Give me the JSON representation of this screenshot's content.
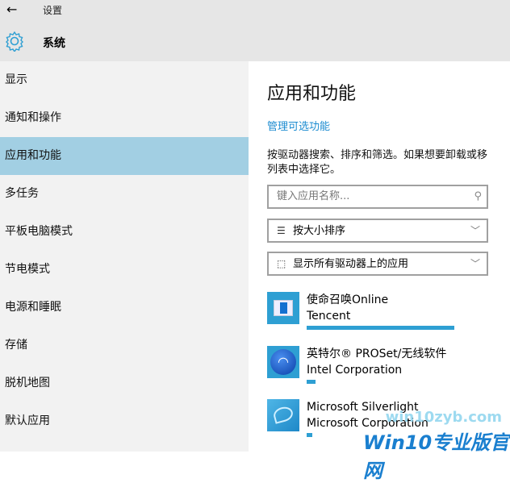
{
  "header": {
    "title": "设置",
    "section": "系统",
    "icons": {
      "back": "arrow-left-icon",
      "section": "gear-icon"
    }
  },
  "sidebar": {
    "items": [
      {
        "label": "显示"
      },
      {
        "label": "通知和操作"
      },
      {
        "label": "应用和功能",
        "selected": true
      },
      {
        "label": "多任务"
      },
      {
        "label": "平板电脑模式"
      },
      {
        "label": "节电模式"
      },
      {
        "label": "电源和睡眠"
      },
      {
        "label": "存储"
      },
      {
        "label": "脱机地图"
      },
      {
        "label": "默认应用"
      }
    ]
  },
  "main": {
    "title": "应用和功能",
    "link": "管理可选功能",
    "description": [
      "按驱动器搜索、排序和筛选。如果想要卸载或移",
      "列表中选择它。"
    ],
    "search": {
      "placeholder": "键入应用名称..."
    },
    "sort": {
      "value": "按大小排序"
    },
    "drive": {
      "value": "显示所有驱动器上的应用"
    },
    "apps": [
      {
        "name": "使命召唤Online",
        "publisher": "Tencent",
        "size_fraction": 1.0
      },
      {
        "name": "英特尔® PROSet/无线软件",
        "publisher": "Intel Corporation",
        "size_fraction": 0.06
      },
      {
        "name": "Microsoft Silverlight",
        "publisher": "Microsoft Corporation",
        "size_fraction": 0.04
      }
    ]
  },
  "watermark": {
    "url": "win10zyb.com",
    "brand": "Win10专业版官网"
  },
  "colors": {
    "accent": "#1b8bd0",
    "selected": "#a2cfe3",
    "bar": "#2e9fd3"
  }
}
